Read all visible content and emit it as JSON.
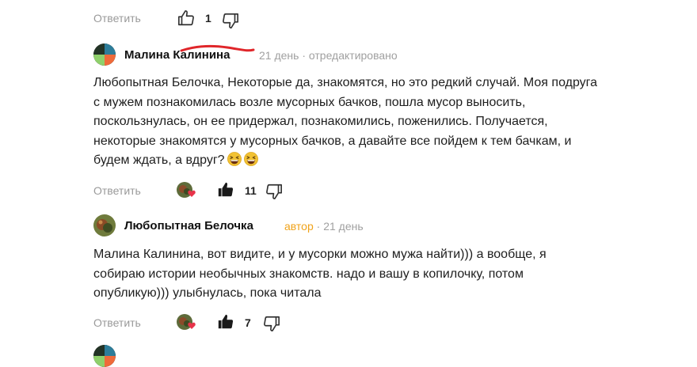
{
  "top_actions": {
    "reply": "Ответить",
    "likes": "1"
  },
  "comments": [
    {
      "author": "Малина Калинина",
      "date": "21 день",
      "edited": "· отредактировано",
      "text": "Любопытная Белочка, Некоторые да, знакомятся, но это редкий случай. Моя подруга с мужем познакомилась возле мусорных бачков, пошла мусор выносить, поскользнулась, он ее придержал, познакомились, поженились. Получается, некоторые знакомятся у мусорных бачков, а давайте все пойдем к тем бачкам, и будем ждать, а вдруг?",
      "emojis": [
        "grinning-squint-emoji",
        "grinning-squint-emoji"
      ],
      "reply": "Ответить",
      "likes": "11"
    },
    {
      "author": "Любопытная Белочка",
      "author_tag": "автор",
      "date": "· 21 день",
      "text": "Малина Калинина, вот видите, и у мусорки можно мужа найти))) а вообще, я собираю истории необычных знакомств. надо и вашу в копилочку, потом опубликую))) улыбнулась, пока читала",
      "reply": "Ответить",
      "likes": "7"
    }
  ],
  "colors": {
    "author_tag": "#f0a31b",
    "meta": "#a0a0a0",
    "reply": "#9a9a9a",
    "redaction": "#e0262a"
  }
}
